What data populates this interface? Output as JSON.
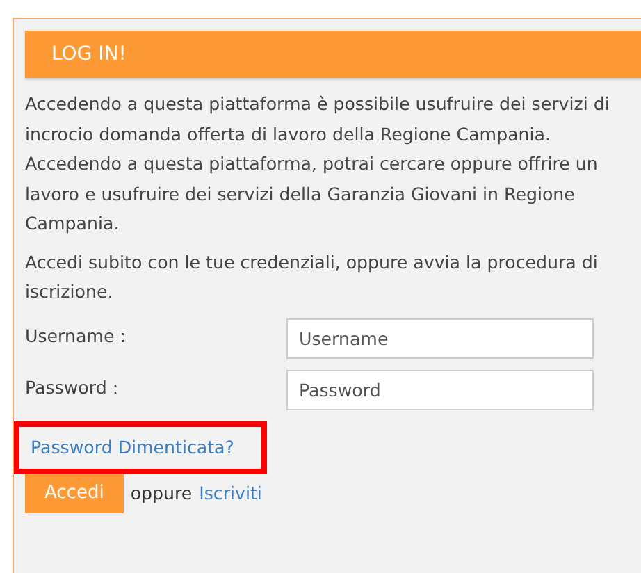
{
  "panel": {
    "title": "LOG IN!"
  },
  "paragraphs": [
    "Accedendo a questa piattaforma è possibile usufruire dei servizi di incrocio domanda offerta di lavoro della Regione Campania.\nAccedendo a questa piattaforma, potrai cercare oppure offrire un lavoro e usufruire dei servizi della Garanzia Giovani in Regione Campania.",
    "Accedi subito con le tue credenziali, oppure avvia la procedura di iscrizione."
  ],
  "fields": [
    {
      "label": "Username :",
      "placeholder": "Username"
    },
    {
      "label": "Password :",
      "placeholder": "Password"
    }
  ],
  "forgot_link": {
    "label": "Password Dimenticata?",
    "highlighted": true
  },
  "submit_button": "Accedi",
  "separator": "oppure",
  "register_link": "Iscriviti"
}
